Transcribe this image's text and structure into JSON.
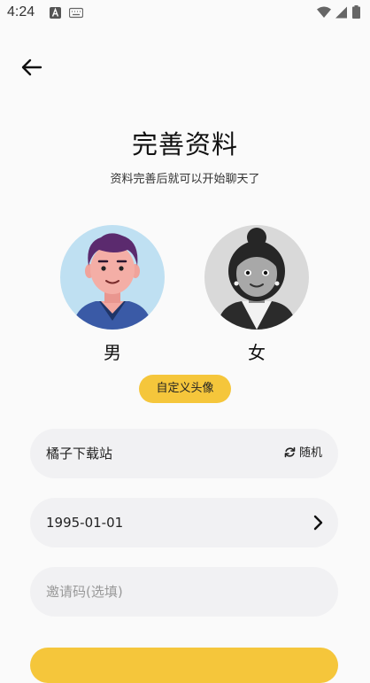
{
  "status_bar": {
    "time": "4:24"
  },
  "header": {
    "title": "完善资料",
    "subtitle": "资料完善后就可以开始聊天了"
  },
  "gender": {
    "male_label": "男",
    "female_label": "女"
  },
  "custom_avatar_label": "自定义头像",
  "form": {
    "nickname_value": "橘子下载站",
    "random_label": "随机",
    "birthday_value": "1995-01-01",
    "invite_placeholder": "邀请码(选填)"
  },
  "colors": {
    "accent": "#f5c63b",
    "field_bg": "#f1f1f3",
    "page_bg": "#fafafa"
  }
}
